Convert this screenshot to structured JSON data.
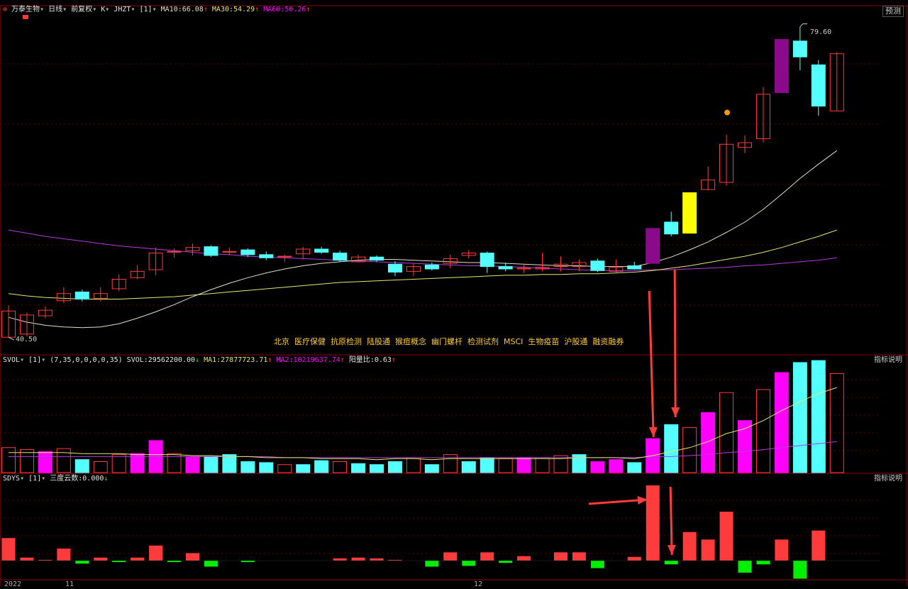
{
  "header": {
    "stock_name": "万泰生物",
    "period": "日线",
    "adjust": "前复权",
    "chart_type": "K",
    "indicator": "JHZT",
    "param": "[1]",
    "ma10": "MA10:66.08",
    "ma30": "MA30:54.29",
    "ma60": "MA60:50.26",
    "predict_button": "预测"
  },
  "price_labels": {
    "high": "79.60",
    "low": "40.50"
  },
  "concepts": [
    "北京",
    "医疗保健",
    "抗原检测",
    "陆股通",
    "猴痘概念",
    "幽门螺杆",
    "检测试剂",
    "MSCI",
    "生物疫苗",
    "沪股通",
    "融资融券"
  ],
  "volume_header": {
    "name": "SVOL",
    "param": "[1]",
    "args": "(7,35,0,0,0,0,35)",
    "svol": "SVOL:29562200.00",
    "ma1": "MA1:27877723.71",
    "ma2": "MA2:10219637.74",
    "ratio": "阳量比:0.63",
    "explain_button": "指标说明"
  },
  "sdys_header": {
    "name": "SDYS",
    "param": "[1]",
    "label": "三度云数:0.000",
    "explain_button": "指标说明"
  },
  "date_axis": {
    "labels": [
      "2022",
      "11",
      "12"
    ]
  },
  "colors": {
    "up": "#ff3b3b",
    "down": "#54ffff",
    "special_purple": "#8b0a8b",
    "special_yellow": "#ffff00",
    "volume_magenta": "#ff00ff",
    "ma10": "#e0e0c0",
    "ma30": "#e6e66e",
    "ma60": "#b43cdc",
    "sdys_pos": "#ff3b3b",
    "sdys_neg": "#00ee00",
    "arrow": "#ff3b3b"
  },
  "chart_data": {
    "type": "candlestick",
    "title": "万泰生物 日线 前复权",
    "ylim": [
      39,
      81
    ],
    "x": [
      "1",
      "2",
      "3",
      "4",
      "5",
      "6",
      "7",
      "8",
      "9",
      "10",
      "11",
      "12",
      "13",
      "14",
      "15",
      "16",
      "17",
      "18",
      "19",
      "20",
      "21",
      "22",
      "23",
      "24",
      "25",
      "26",
      "27",
      "28",
      "29",
      "30",
      "31",
      "32",
      "33",
      "34",
      "35",
      "36",
      "37",
      "38",
      "39",
      "40",
      "41",
      "42",
      "43",
      "44",
      "45",
      "46"
    ],
    "candles": [
      {
        "o": 40.5,
        "c": 43.8,
        "h": 44.5,
        "l": 40.5,
        "s": "up"
      },
      {
        "o": 43.3,
        "c": 40.9,
        "h": 43.6,
        "l": 40.6,
        "s": "up"
      },
      {
        "o": 43.2,
        "c": 43.9,
        "h": 44.4,
        "l": 42.9,
        "s": "up"
      },
      {
        "o": 45.1,
        "c": 46.0,
        "h": 46.8,
        "l": 44.8,
        "s": "up"
      },
      {
        "o": 46.2,
        "c": 45.3,
        "h": 46.5,
        "l": 45.0,
        "s": "down"
      },
      {
        "o": 45.4,
        "c": 46.0,
        "h": 46.8,
        "l": 45.0,
        "s": "up"
      },
      {
        "o": 46.6,
        "c": 47.8,
        "h": 48.4,
        "l": 46.3,
        "s": "up"
      },
      {
        "o": 48.0,
        "c": 48.8,
        "h": 49.6,
        "l": 47.8,
        "s": "up"
      },
      {
        "o": 49.0,
        "c": 51.1,
        "h": 51.8,
        "l": 48.3,
        "s": "up"
      },
      {
        "o": 51.3,
        "c": 51.3,
        "h": 51.7,
        "l": 50.5,
        "s": "up"
      },
      {
        "o": 51.4,
        "c": 51.8,
        "h": 52.3,
        "l": 50.8,
        "s": "up"
      },
      {
        "o": 51.9,
        "c": 50.8,
        "h": 52.1,
        "l": 50.6,
        "s": "down"
      },
      {
        "o": 51.3,
        "c": 51.3,
        "h": 51.8,
        "l": 50.8,
        "s": "up"
      },
      {
        "o": 51.5,
        "c": 50.9,
        "h": 51.7,
        "l": 50.6,
        "s": "down"
      },
      {
        "o": 50.9,
        "c": 50.5,
        "h": 51.3,
        "l": 50.2,
        "s": "down"
      },
      {
        "o": 50.7,
        "c": 50.7,
        "h": 50.9,
        "l": 50.0,
        "s": "up"
      },
      {
        "o": 51.0,
        "c": 51.6,
        "h": 51.9,
        "l": 50.3,
        "s": "up"
      },
      {
        "o": 51.6,
        "c": 51.2,
        "h": 51.9,
        "l": 51.0,
        "s": "down"
      },
      {
        "o": 51.1,
        "c": 50.2,
        "h": 51.4,
        "l": 50.0,
        "s": "down"
      },
      {
        "o": 50.0,
        "c": 50.6,
        "h": 50.9,
        "l": 49.9,
        "s": "up"
      },
      {
        "o": 50.6,
        "c": 50.2,
        "h": 50.8,
        "l": 50.0,
        "s": "down"
      },
      {
        "o": 49.7,
        "c": 48.7,
        "h": 50.1,
        "l": 48.2,
        "s": "down"
      },
      {
        "o": 48.8,
        "c": 49.4,
        "h": 49.8,
        "l": 48.2,
        "s": "up"
      },
      {
        "o": 49.6,
        "c": 49.1,
        "h": 49.9,
        "l": 48.9,
        "s": "down"
      },
      {
        "o": 49.8,
        "c": 50.4,
        "h": 50.9,
        "l": 49.2,
        "s": "up"
      },
      {
        "o": 50.8,
        "c": 51.1,
        "h": 51.5,
        "l": 50.4,
        "s": "up"
      },
      {
        "o": 51.1,
        "c": 49.4,
        "h": 51.3,
        "l": 48.6,
        "s": "down"
      },
      {
        "o": 49.4,
        "c": 49.1,
        "h": 49.9,
        "l": 48.8,
        "s": "down"
      },
      {
        "o": 49.2,
        "c": 49.1,
        "h": 49.6,
        "l": 48.6,
        "s": "up"
      },
      {
        "o": 49.3,
        "c": 49.1,
        "h": 51.1,
        "l": 48.8,
        "s": "up"
      },
      {
        "o": 49.4,
        "c": 49.7,
        "h": 50.7,
        "l": 48.8,
        "s": "up"
      },
      {
        "o": 49.9,
        "c": 49.4,
        "h": 50.3,
        "l": 48.8,
        "s": "up"
      },
      {
        "o": 50.1,
        "c": 48.9,
        "h": 50.4,
        "l": 48.7,
        "s": "down"
      },
      {
        "o": 49.3,
        "c": 48.8,
        "h": 50.3,
        "l": 48.6,
        "s": "up"
      },
      {
        "o": 49.5,
        "c": 49.1,
        "h": 50.0,
        "l": 49.0,
        "s": "down"
      },
      {
        "o": 49.8,
        "c": 54.2,
        "h": 54.2,
        "l": 49.8,
        "s": "purple"
      },
      {
        "o": 55.0,
        "c": 53.5,
        "h": 56.3,
        "l": 53.2,
        "s": "down"
      },
      {
        "o": 53.6,
        "c": 58.7,
        "h": 58.7,
        "l": 53.6,
        "s": "yellow"
      },
      {
        "o": 59.1,
        "c": 60.3,
        "h": 62.0,
        "l": 59.0,
        "s": "up"
      },
      {
        "o": 60.0,
        "c": 64.8,
        "h": 66.0,
        "l": 59.6,
        "s": "up"
      },
      {
        "o": 64.4,
        "c": 65.0,
        "h": 65.9,
        "l": 63.7,
        "s": "up"
      },
      {
        "o": 65.5,
        "c": 71.1,
        "h": 72.0,
        "l": 65.0,
        "s": "up"
      },
      {
        "o": 71.3,
        "c": 78.0,
        "h": 78.0,
        "l": 71.3,
        "s": "purple"
      },
      {
        "o": 77.8,
        "c": 75.8,
        "h": 79.6,
        "l": 74.1,
        "s": "down"
      },
      {
        "o": 74.8,
        "c": 69.6,
        "h": 75.4,
        "l": 68.4,
        "s": "down"
      },
      {
        "o": 69.0,
        "c": 76.2,
        "h": 76.4,
        "l": 69.0,
        "s": "up"
      }
    ],
    "ma10": [
      43.0,
      42.4,
      42.0,
      41.8,
      41.7,
      41.8,
      42.2,
      42.9,
      43.7,
      44.6,
      45.6,
      46.5,
      47.3,
      48.0,
      48.6,
      49.1,
      49.5,
      49.8,
      50.0,
      50.2,
      50.3,
      50.3,
      50.2,
      50.1,
      50.0,
      49.9,
      49.9,
      49.8,
      49.7,
      49.6,
      49.5,
      49.5,
      49.4,
      49.4,
      49.4,
      49.9,
      50.6,
      51.5,
      52.5,
      53.7,
      55.0,
      56.6,
      58.5,
      60.5,
      62.3,
      64.0
    ],
    "ma30": [
      46.0,
      45.7,
      45.5,
      45.4,
      45.3,
      45.3,
      45.3,
      45.4,
      45.5,
      45.6,
      45.8,
      46.0,
      46.2,
      46.4,
      46.6,
      46.8,
      47.0,
      47.2,
      47.4,
      47.5,
      47.6,
      47.7,
      47.8,
      47.9,
      48.0,
      48.1,
      48.2,
      48.3,
      48.3,
      48.4,
      48.4,
      48.5,
      48.5,
      48.6,
      48.7,
      48.9,
      49.2,
      49.5,
      49.9,
      50.3,
      50.7,
      51.2,
      51.8,
      52.5,
      53.2,
      54.0
    ],
    "ma60": [
      54.0,
      53.6,
      53.2,
      52.9,
      52.6,
      52.3,
      52.0,
      51.8,
      51.6,
      51.4,
      51.2,
      51.0,
      50.9,
      50.7,
      50.6,
      50.5,
      50.4,
      50.3,
      50.2,
      50.1,
      50.0,
      49.9,
      49.8,
      49.7,
      49.6,
      49.5,
      49.5,
      49.4,
      49.3,
      49.2,
      49.1,
      49.0,
      48.9,
      48.9,
      48.9,
      49.0,
      49.0,
      49.1,
      49.2,
      49.3,
      49.5,
      49.6,
      49.8,
      50.0,
      50.2,
      50.5
    ],
    "volume": {
      "ylim": [
        0,
        100
      ],
      "values": [
        25,
        23,
        21,
        24,
        13,
        11,
        18,
        19,
        32,
        19,
        16,
        16,
        18,
        11,
        10,
        8,
        8,
        12,
        11,
        9,
        8,
        11,
        15,
        8,
        18,
        11,
        15,
        14,
        15,
        15,
        17,
        18,
        11,
        13,
        10,
        34,
        48,
        45,
        60,
        80,
        52,
        83,
        100,
        110,
        112,
        99
      ],
      "colors": [
        "up",
        "up",
        "mag",
        "up",
        "down",
        "up",
        "up",
        "mag",
        "mag",
        "up",
        "mag",
        "down",
        "down",
        "down",
        "down",
        "up",
        "down",
        "down",
        "up",
        "down",
        "down",
        "down",
        "up",
        "down",
        "up",
        "down",
        "down",
        "up",
        "mag",
        "up",
        "up",
        "down",
        "mag",
        "mag",
        "down",
        "mag",
        "down",
        "up",
        "mag",
        "up",
        "mag",
        "up",
        "mag",
        "down",
        "down",
        "up"
      ],
      "ma1": [
        20,
        20,
        20,
        20,
        19,
        19,
        19,
        18,
        18,
        18,
        17,
        17,
        16,
        16,
        15,
        15,
        15,
        14,
        14,
        14,
        13,
        14,
        14,
        13,
        14,
        14,
        14,
        14,
        14,
        14,
        14,
        15,
        15,
        15,
        14,
        17,
        21,
        25,
        31,
        39,
        44,
        52,
        62,
        71,
        79,
        85
      ],
      "ma2": [
        16,
        16,
        16,
        16,
        16,
        16,
        16,
        16,
        16,
        16,
        16,
        16,
        16,
        16,
        16,
        15,
        15,
        15,
        15,
        15,
        15,
        15,
        15,
        15,
        15,
        15,
        15,
        15,
        15,
        15,
        15,
        15,
        15,
        15,
        15,
        16,
        16,
        17,
        18,
        20,
        21,
        23,
        25,
        27,
        29,
        31
      ]
    },
    "sdys": {
      "ylim": [
        -25,
        100
      ],
      "values": [
        30,
        4,
        1,
        16,
        -4,
        4,
        -2,
        4,
        20,
        -2,
        10,
        -8,
        0,
        -2,
        0,
        0,
        0,
        0,
        3,
        4,
        3,
        1,
        0,
        -8,
        11,
        -7,
        11,
        -3,
        6,
        0,
        11,
        11,
        -10,
        0,
        5,
        100,
        -5,
        38,
        28,
        65,
        -16,
        -5,
        28,
        -24,
        40,
        0
      ]
    }
  }
}
